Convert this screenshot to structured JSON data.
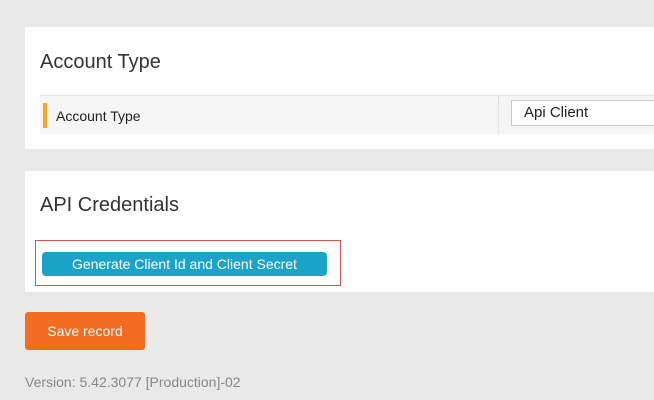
{
  "account_section": {
    "title": "Account Type",
    "field": {
      "label": "Account Type",
      "value": "Api Client"
    }
  },
  "api_section": {
    "title": "API Credentials",
    "generate_button_label": "Generate Client Id and Client Secret"
  },
  "actions": {
    "save_label": "Save record"
  },
  "footer": {
    "version": "Version: 5.42.3077 [Production]-02"
  },
  "colors": {
    "background": "#e9e9e9",
    "panel": "#ffffff",
    "required_marker": "#f5a623",
    "generate_button": "#1ba3c8",
    "save_button": "#f26d21",
    "highlight_border": "#d9534f"
  }
}
